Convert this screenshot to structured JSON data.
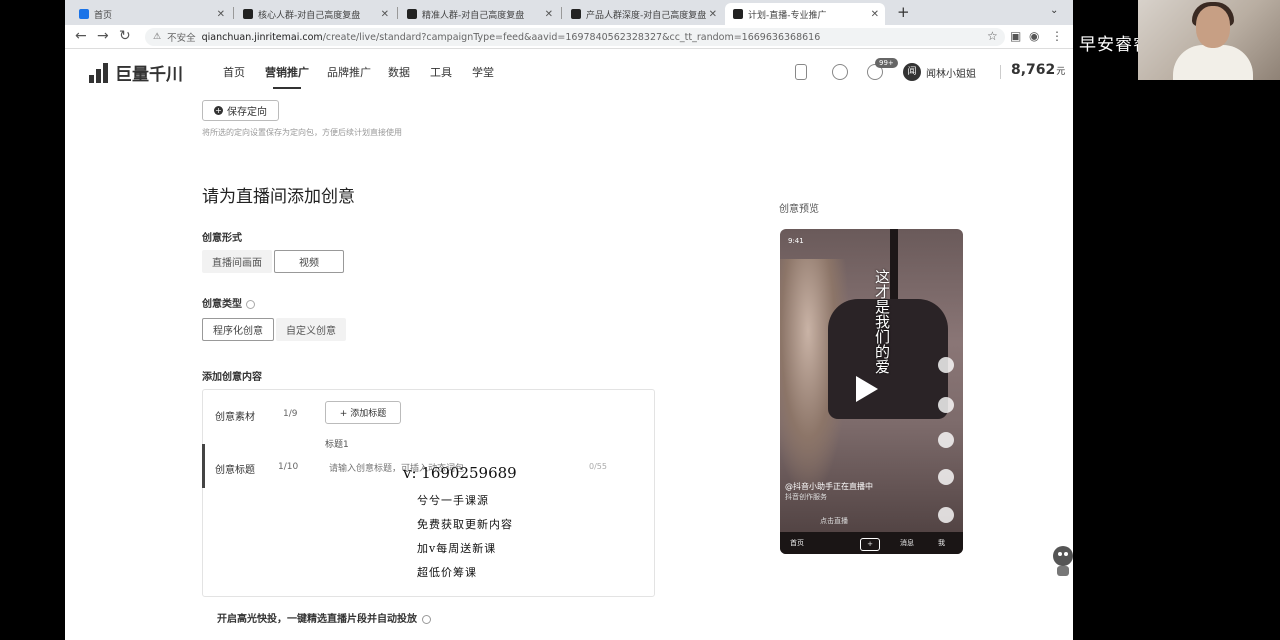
{
  "browser": {
    "tabs": [
      {
        "title": "首页"
      },
      {
        "title": "核心人群-对自己高度复盘"
      },
      {
        "title": "精准人群-对自己高度复盘"
      },
      {
        "title": "产品人群深度-对自己高度复盘"
      },
      {
        "title": "计划-直播-专业推广"
      }
    ],
    "security_label": "不安全",
    "url_host": "qianchuan.jinritemai.com",
    "url_path": "/create/live/standard?campaignType=feed&aavid=1697840562328327&cc_tt_random=1669636368616"
  },
  "site": {
    "logo_text": "巨量千川",
    "nav": [
      "首页",
      "营销推广",
      "品牌推广",
      "数据",
      "工具",
      "学堂"
    ],
    "notification_badge": "99+",
    "avatar_letter": "闻",
    "username": "闻林小姐姐",
    "balance": "8,762",
    "balance_unit": "元"
  },
  "page": {
    "save_button": "保存定向",
    "save_hint": "将所选的定向设置保存为定向包，方便后续计划直接使用",
    "section_title": "请为直播间添加创意",
    "creative_form_label": "创意形式",
    "creative_form_options": [
      "直播间画面",
      "视频"
    ],
    "creative_type_label": "创意类型",
    "creative_type_options": [
      "程序化创意",
      "自定义创意"
    ],
    "add_content_label": "添加创意内容",
    "material_label": "创意素材",
    "material_count": "1/9",
    "add_title_button": "+ 添加标题",
    "title_tag": "标题1",
    "title_label": "创意标题",
    "title_count": "1/10",
    "title_placeholder": "请输入创意标题，可插入动态词包",
    "char_count": "0/55",
    "bottom_text": "开启高光快投，一键精选直播片段并自动投放"
  },
  "overlay_promo": {
    "contact": "v: 1690259689",
    "lines": [
      "兮兮一手课源",
      "免费获取更新内容",
      "加v每周送新课",
      "超低价筹课"
    ]
  },
  "preview": {
    "label": "创意预览",
    "status": "9:41",
    "vertical_text": "这才是我们的爱",
    "caption": "@抖音小助手正在直播中",
    "caption_sub": "抖音创作服务",
    "hint": "点击直播",
    "nav": [
      "首页",
      "消息",
      "我"
    ]
  },
  "webcam": {
    "title": "早安睿睿"
  }
}
